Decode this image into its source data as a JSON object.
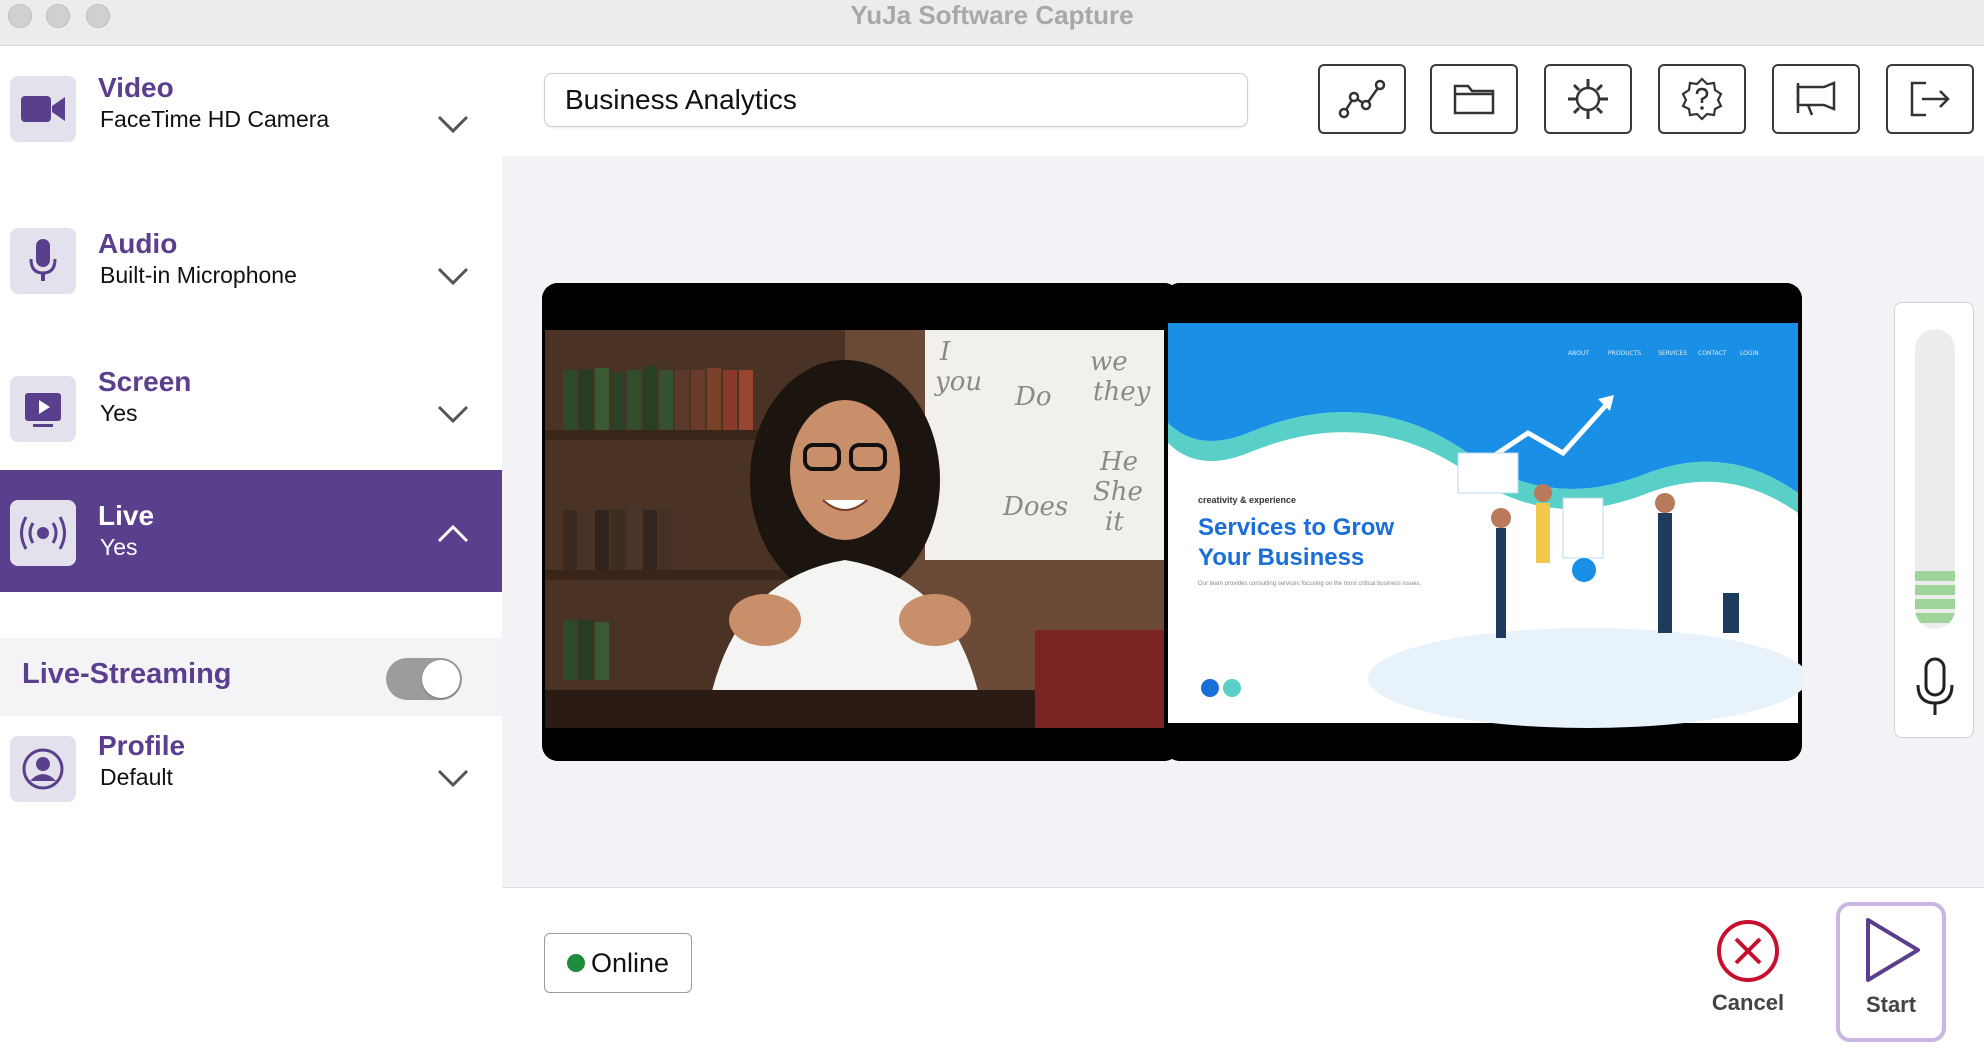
{
  "window": {
    "title": "YuJa Software Capture"
  },
  "sidebar": {
    "items": [
      {
        "key": "video",
        "title": "Video",
        "subtitle": "FaceTime HD Camera",
        "icon": "video-camera-icon",
        "expanded": false
      },
      {
        "key": "audio",
        "title": "Audio",
        "subtitle": "Built-in Microphone",
        "icon": "microphone-icon",
        "expanded": false
      },
      {
        "key": "screen",
        "title": "Screen",
        "subtitle": "Yes",
        "icon": "screen-play-icon",
        "expanded": false
      },
      {
        "key": "live",
        "title": "Live",
        "subtitle": "Yes",
        "icon": "broadcast-icon",
        "expanded": true
      },
      {
        "key": "profile",
        "title": "Profile",
        "subtitle": "Default",
        "icon": "user-circle-icon",
        "expanded": false
      }
    ],
    "live_streaming": {
      "label": "Live-Streaming",
      "enabled": true
    }
  },
  "toolbar": {
    "recording_title": "Business Analytics",
    "buttons": [
      {
        "name": "analytics-button",
        "icon": "line-graph-icon"
      },
      {
        "name": "folder-button",
        "icon": "folder-icon"
      },
      {
        "name": "settings-button",
        "icon": "gear-icon"
      },
      {
        "name": "help-button",
        "icon": "help-badge-icon"
      },
      {
        "name": "announcement-button",
        "icon": "megaphone-icon"
      },
      {
        "name": "sign-out-button",
        "icon": "sign-out-icon"
      }
    ]
  },
  "preview": {
    "slide": {
      "kicker": "creativity & experience",
      "headline_line1": "Services to Grow",
      "headline_line2": "Your Business",
      "body": "Our team provides consulting services focusing on the most critical business issues.",
      "nav": [
        "ABOUT",
        "PRODUCTS",
        "SERVICES",
        "CONTACT",
        "LOGIN"
      ]
    },
    "whiteboard_text": [
      "I",
      "you",
      "we",
      "they",
      "Do",
      "Does",
      "He",
      "She",
      "it"
    ],
    "audio_level": 0.18
  },
  "footer": {
    "status": "Online",
    "cancel_label": "Cancel",
    "start_label": "Start"
  },
  "colors": {
    "brand_purple": "#5a3f8d",
    "cancel_red": "#c8102e",
    "online_green": "#1e8e3e",
    "meter_green": "#9fd49a"
  }
}
